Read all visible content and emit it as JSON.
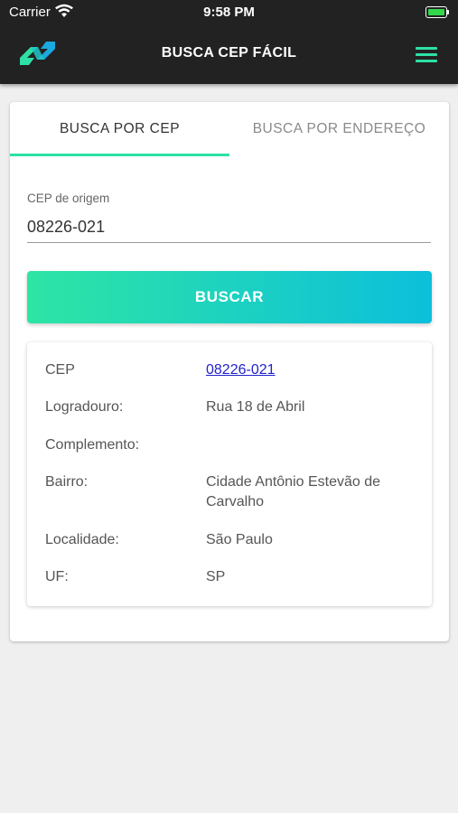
{
  "status_bar": {
    "carrier": "Carrier",
    "time": "9:58 PM"
  },
  "header": {
    "title": "BUSCA CEP FÁCIL",
    "menu_icon": "hamburger-menu-icon",
    "accent_color": "#2ee0a6"
  },
  "tabs": [
    {
      "label": "BUSCA POR CEP",
      "active": true
    },
    {
      "label": "BUSCA POR ENDEREÇO",
      "active": false
    }
  ],
  "cep_field": {
    "label": "CEP de origem",
    "value": "08226-021"
  },
  "search_button": {
    "label": "BUSCAR"
  },
  "result": {
    "rows": [
      {
        "key": "CEP",
        "value": "08226-021"
      },
      {
        "key": "Logradouro:",
        "value": "Rua 18 de Abril"
      },
      {
        "key": "Complemento:",
        "value": ""
      },
      {
        "key": "Bairro:",
        "value": "Cidade Antônio Estevão de Carvalho"
      },
      {
        "key": "Localidade:",
        "value": "São Paulo"
      },
      {
        "key": "UF:",
        "value": "SP"
      }
    ]
  }
}
